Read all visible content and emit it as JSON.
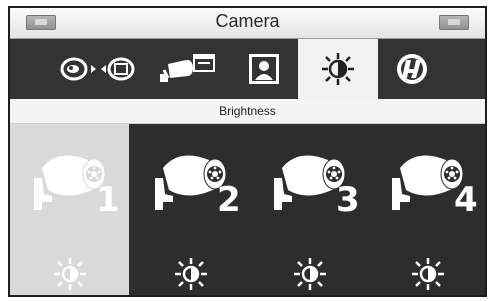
{
  "header": {
    "title": "Camera",
    "left_button_icon": "back-icon",
    "right_button_icon": "home-icon"
  },
  "tabs": [
    {
      "id": "camera-switch",
      "icon": "camera-switch-icon",
      "active": false
    },
    {
      "id": "camera-record",
      "icon": "camera-video-icon",
      "active": false
    },
    {
      "id": "portrait",
      "icon": "portrait-icon",
      "active": false
    },
    {
      "id": "brightness",
      "icon": "brightness-icon",
      "active": true
    },
    {
      "id": "flicker",
      "icon": "flicker-icon",
      "active": false
    }
  ],
  "section": {
    "label": "Brightness"
  },
  "cameras": [
    {
      "number": "1",
      "selected": true
    },
    {
      "number": "2",
      "selected": false
    },
    {
      "number": "3",
      "selected": false
    },
    {
      "number": "4",
      "selected": false
    }
  ],
  "colors": {
    "background": "#2b2b2b",
    "active_tab": "#f2f2f2",
    "selected_cell": "#d9d9d9",
    "icon": "#ffffff"
  }
}
